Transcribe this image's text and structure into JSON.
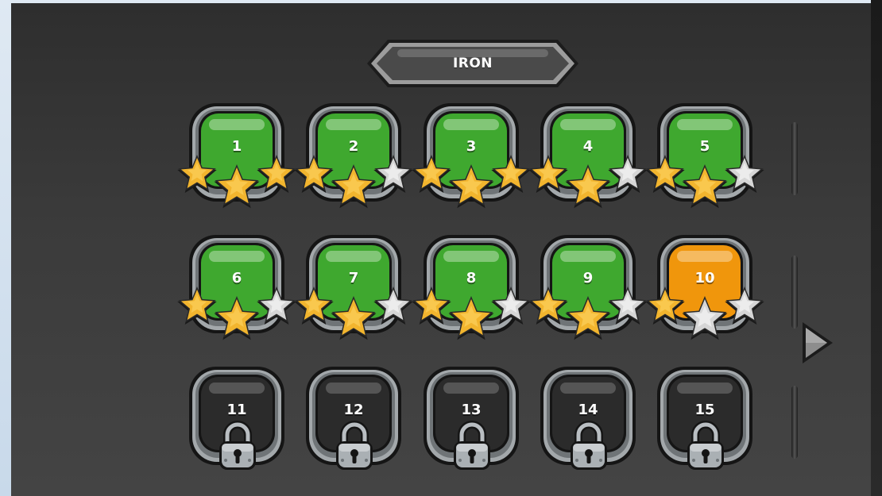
{
  "header": {
    "world_title": "IRON"
  },
  "levels": [
    {
      "label": "1",
      "state": "completed",
      "stars": 3
    },
    {
      "label": "2",
      "state": "completed",
      "stars": 2
    },
    {
      "label": "3",
      "state": "completed",
      "stars": 3
    },
    {
      "label": "4",
      "state": "completed",
      "stars": 2
    },
    {
      "label": "5",
      "state": "completed",
      "stars": 2
    },
    {
      "label": "6",
      "state": "completed",
      "stars": 2
    },
    {
      "label": "7",
      "state": "completed",
      "stars": 2
    },
    {
      "label": "8",
      "state": "completed",
      "stars": 2
    },
    {
      "label": "9",
      "state": "completed",
      "stars": 2
    },
    {
      "label": "10",
      "state": "current",
      "stars": 1
    },
    {
      "label": "11",
      "state": "locked",
      "stars": 0
    },
    {
      "label": "12",
      "state": "locked",
      "stars": 0
    },
    {
      "label": "13",
      "state": "locked",
      "stars": 0
    },
    {
      "label": "14",
      "state": "locked",
      "stars": 0
    },
    {
      "label": "15",
      "state": "locked",
      "stars": 0
    }
  ],
  "icons": {
    "next": "chevron-right-icon",
    "star": "star-icon",
    "lock": "padlock-icon"
  },
  "colors": {
    "completed": "#3fa82f",
    "current": "#f0960c",
    "locked": "#2b2b2b",
    "star_gold": "#f2b52e",
    "star_silver": "#d6d6d6"
  }
}
